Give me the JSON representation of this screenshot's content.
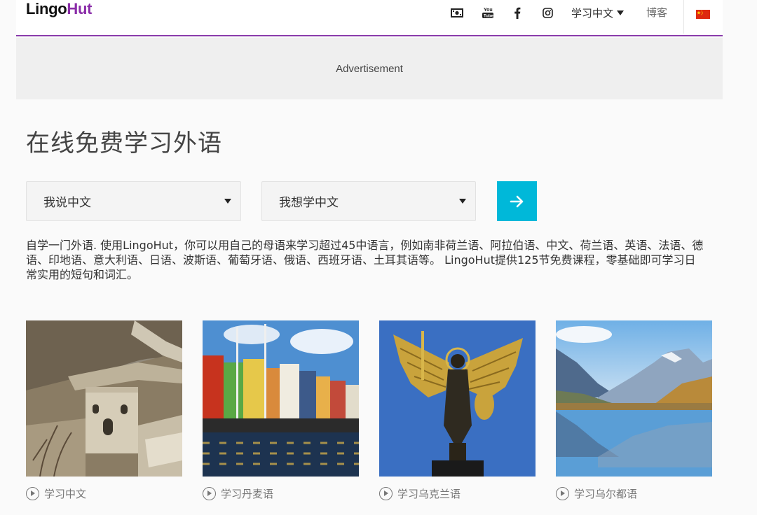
{
  "header": {
    "logo_part1": "Lingo",
    "logo_part2": "Hut",
    "icons": [
      "money-icon",
      "youtube-icon",
      "facebook-icon",
      "instagram-icon"
    ],
    "interface_language": "学习中文",
    "blog_label": "博客",
    "flag": "china-flag-icon",
    "accent_color": "#8a3cab"
  },
  "ad": {
    "label": "Advertisement"
  },
  "main": {
    "title": "在线免费学习外语",
    "native_select": "我说中文",
    "target_select": "我想学中文",
    "go_color": "#00b8d9",
    "description": "自学一门外语. 使用LingoHut，你可以用自己的母语来学习超过45中语言，例如南非荷兰语、阿拉伯语、中文、荷兰语、英语、法语、德语、印地语、意大利语、日语、波斯语、葡萄牙语、俄语、西班牙语、土耳其语等。 LingoHut提供125节免费课程，零基础即可学习日常实用的短句和词汇。"
  },
  "cards": [
    {
      "label": "学习中文"
    },
    {
      "label": "学习丹麦语"
    },
    {
      "label": "学习乌克兰语"
    },
    {
      "label": "学习乌尔都语"
    }
  ]
}
